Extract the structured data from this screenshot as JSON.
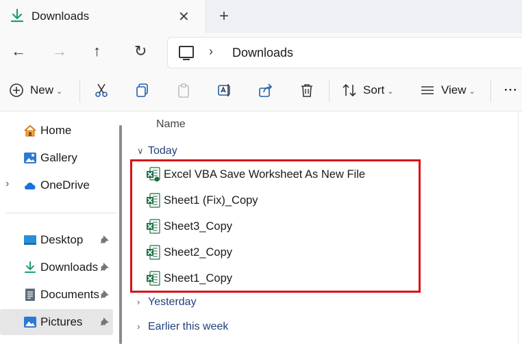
{
  "tab": {
    "title": "Downloads",
    "close_glyph": "✕",
    "new_glyph": "+"
  },
  "nav": {
    "back_glyph": "←",
    "forward_glyph": "→",
    "up_glyph": "↑",
    "refresh_glyph": "↻"
  },
  "address": {
    "separator": "›",
    "path": "Downloads"
  },
  "toolbar": {
    "new_label": "New",
    "sort_label": "Sort",
    "view_label": "View",
    "more_glyph": "···"
  },
  "sidebar": {
    "items": [
      {
        "label": "Home",
        "icon": "home-icon"
      },
      {
        "label": "Gallery",
        "icon": "gallery-icon"
      },
      {
        "label": "OneDrive",
        "icon": "cloud-icon"
      },
      {
        "label": "Desktop",
        "icon": "desktop-icon"
      },
      {
        "label": "Downloads",
        "icon": "download-icon"
      },
      {
        "label": "Documents",
        "icon": "document-icon"
      },
      {
        "label": "Pictures",
        "icon": "pictures-icon"
      }
    ]
  },
  "content": {
    "column_header": "Name",
    "groups": {
      "today": "Today",
      "yesterday": "Yesterday",
      "earlier": "Earlier this week"
    },
    "files": [
      {
        "name": "Excel VBA Save Worksheet As New File",
        "icon": "excel-macro-icon"
      },
      {
        "name": "Sheet1 (Fix)_Copy",
        "icon": "excel-icon"
      },
      {
        "name": "Sheet3_Copy",
        "icon": "excel-icon"
      },
      {
        "name": "Sheet2_Copy",
        "icon": "excel-icon"
      },
      {
        "name": "Sheet1_Copy",
        "icon": "excel-icon"
      }
    ]
  },
  "colors": {
    "accent": "#1f3f7a",
    "highlight": "#d80f16",
    "excel": "#1d6f42",
    "selected": "#e6e6e6"
  }
}
